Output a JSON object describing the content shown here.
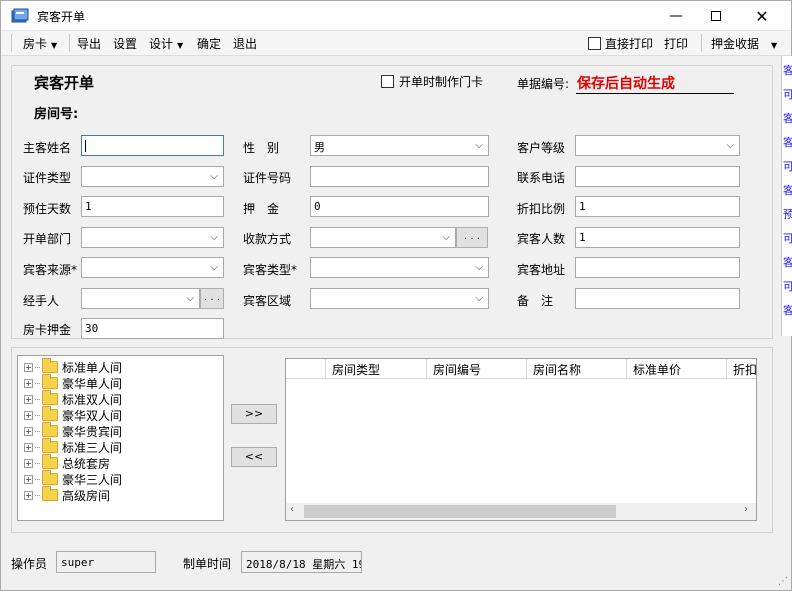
{
  "window": {
    "title": "宾客开单"
  },
  "menu": {
    "items": [
      "房卡",
      "导出",
      "设置",
      "设计",
      "确定",
      "退出"
    ],
    "direct_print_label": "直接打印",
    "print_label": "打印",
    "deposit_receipt_label": "押金收据"
  },
  "form": {
    "heading": "宾客开单",
    "make_card_label": "开单时制作门卡",
    "bill_no_label": "单据编号:",
    "bill_no_value": "保存后自动生成",
    "room_no_label": "房间号:",
    "fields": {
      "main_guest_name": {
        "label": "主客姓名",
        "value": ""
      },
      "gender": {
        "label": "性　别",
        "value": "男"
      },
      "customer_level": {
        "label": "客户等级",
        "value": ""
      },
      "id_type": {
        "label": "证件类型",
        "value": ""
      },
      "id_number": {
        "label": "证件号码",
        "value": ""
      },
      "phone": {
        "label": "联系电话",
        "value": ""
      },
      "stay_days": {
        "label": "预住天数",
        "value": "1"
      },
      "deposit": {
        "label": "押　金",
        "value": "0"
      },
      "discount": {
        "label": "折扣比例",
        "value": "1"
      },
      "department": {
        "label": "开单部门",
        "value": ""
      },
      "payment_method": {
        "label": "收款方式",
        "value": ""
      },
      "guest_count": {
        "label": "宾客人数",
        "value": "1"
      },
      "guest_source": {
        "label": "宾客来源*",
        "value": ""
      },
      "guest_type": {
        "label": "宾客类型*",
        "value": ""
      },
      "guest_address": {
        "label": "宾客地址",
        "value": ""
      },
      "handler": {
        "label": "经手人",
        "value": ""
      },
      "guest_area": {
        "label": "宾客区域",
        "value": ""
      },
      "remark": {
        "label": "备　注",
        "value": ""
      },
      "card_deposit": {
        "label": "房卡押金",
        "value": "30"
      }
    },
    "ellipsis": ". . ."
  },
  "tree": {
    "nodes": [
      "标准单人间",
      "豪华单人间",
      "标准双人间",
      "豪华双人间",
      "豪华贵宾间",
      "标准三人间",
      "总统套房",
      "豪华三人间",
      "高级房间"
    ]
  },
  "transfer": {
    "add_label": ">>",
    "remove_label": "<<"
  },
  "grid": {
    "columns": [
      "",
      "房间类型",
      "房间编号",
      "房间名称",
      "标准单价",
      "折扣"
    ]
  },
  "footer": {
    "operator_label": "操作员",
    "operator_value": "super",
    "time_label": "制单时间",
    "time_value": "2018/8/18 星期六 19"
  },
  "right_strip": [
    "客",
    "可",
    "客",
    "客",
    "可",
    "客",
    "预",
    "可",
    "客",
    "可",
    "客"
  ]
}
